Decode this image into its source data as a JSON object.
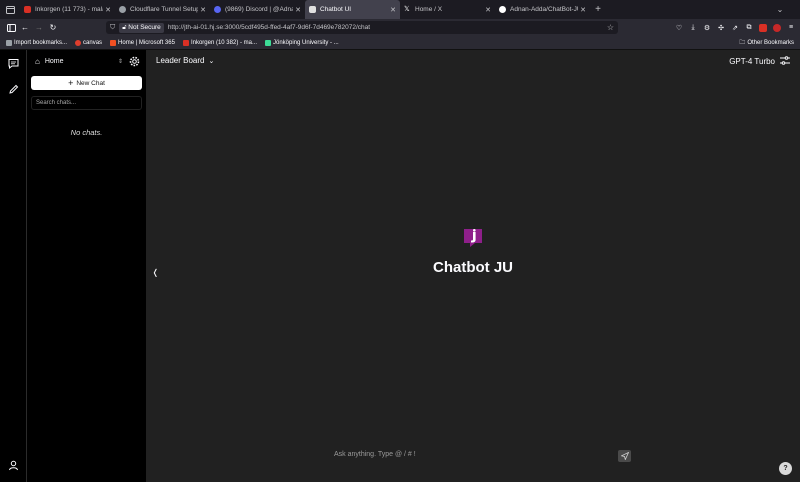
{
  "browser": {
    "tabs": [
      {
        "title": "Inkorgen (11 773) - mala...",
        "favicon_color": "#d93025"
      },
      {
        "title": "Cloudflare Tunnel Setup",
        "favicon_color": "#9aa0a6"
      },
      {
        "title": "(9869) Discord | @Adnan",
        "favicon_color": "#5865f2"
      },
      {
        "title": "Chatbot UI",
        "favicon_color": "#e0e0e0",
        "active": true
      },
      {
        "title": "Home / X",
        "favicon_color": "#ffffff"
      },
      {
        "title": "Adnan-Adda/ChatBot-JU",
        "favicon_color": "#ffffff"
      }
    ],
    "new_tab": "+",
    "url_security": "Not Secure",
    "url": "http://jth-ai-01.hj.se:3000/5cdf495d-ffed-4af7-9d6f-7d469e782072/chat",
    "bookmarks": [
      {
        "label": "Import bookmarks...",
        "color": "#9aa0a6"
      },
      {
        "label": "canvas",
        "color": "#e03e2d"
      },
      {
        "label": "Home | Microsoft 365",
        "color": "#f25022"
      },
      {
        "label": "Inkorgen (10 382) - ma...",
        "color": "#d93025"
      },
      {
        "label": "Jönköping University - ...",
        "color": "#3ddc97"
      }
    ],
    "other_bookmarks": "Other Bookmarks"
  },
  "sidebar": {
    "workspace": "Home",
    "new_chat": "New Chat",
    "search_placeholder": "Search chats...",
    "empty": "No chats."
  },
  "main": {
    "leaderboard": "Leader Board",
    "model": "GPT-4 Turbo",
    "collapse_glyph": "❬",
    "brand": "Chatbot JU",
    "brand_color": "#8e1f8a",
    "input_placeholder": "Ask anything. Type @  /  #  !",
    "help": "?"
  }
}
